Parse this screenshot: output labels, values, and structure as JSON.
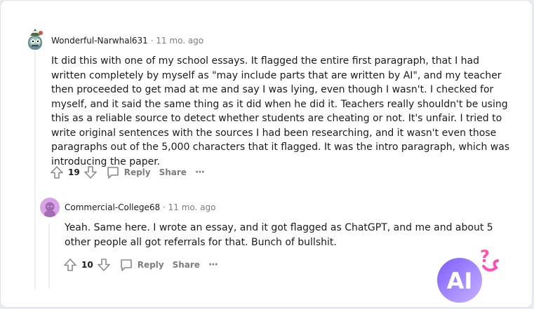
{
  "comments": [
    {
      "username": "Wonderful-Narwhal631",
      "separator": "·",
      "time": "11 mo. ago",
      "paragraph": "It did this with one of my school essays. It flagged the entire first paragraph, that I had written completely by myself as \"may include parts that are written by AI\", and my teacher then proceeded to get mad at me and say I was lying, even though I wasn't. I checked for myself, and it said the same thing as it did when he did it. Teachers really shouldn't be using this as a reliable source to detect whether students are cheating or not. It's unfair. I tried to write original sentences with the sources I had been researching, and it wasn't even those paragraphs out of the 5,000 characters that it flagged. It was the intro paragraph, which was introducing the paper.",
      "score": "19",
      "reply_label": "Reply",
      "share_label": "Share",
      "more_label": "···"
    },
    {
      "username": "Commercial-College68",
      "separator": "·",
      "time": "11 mo. ago",
      "paragraph": "Yeah. Same here. I wrote an essay, and it got flagged as ChatGPT, and me and about 5 other people all got referrals for that. Bunch of bullshit.",
      "score": "10",
      "reply_label": "Reply",
      "share_label": "Share",
      "more_label": "···"
    }
  ],
  "badge": {
    "text": "AI",
    "mark": "?"
  },
  "icons": {
    "upvote": "arrow-up-icon",
    "downvote": "arrow-down-icon",
    "reply": "speech-bubble-icon",
    "more": "ellipsis-icon",
    "avatar1": "narwhal-avatar-icon",
    "avatar2": "snoo-avatar-icon"
  },
  "colors": {
    "username": "#1a1a1b",
    "meta_gray": "#7c7c7c",
    "action_gray": "#878a8c",
    "thread_line": "#edeff1",
    "avatar2_bg": "#d7a3e6",
    "badge_gradient_start": "#7b5cff",
    "badge_gradient_end": "#c7b3ff",
    "badge_mark": "#ff4fb1"
  }
}
